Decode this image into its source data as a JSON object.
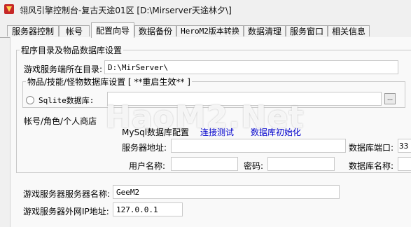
{
  "window": {
    "title": "翎风引擎控制台-复古天途01区 [D:\\Mirserver天途林夕\\]"
  },
  "tabs": [
    {
      "label": "服务器控制"
    },
    {
      "label": "帐号"
    },
    {
      "label": "配置向导"
    },
    {
      "label": "数据备份"
    },
    {
      "label": "HeroM2版本转换"
    },
    {
      "label": "数据清理"
    },
    {
      "label": "服务窗口"
    },
    {
      "label": "相关信息"
    }
  ],
  "active_tab": "配置向导",
  "wizard": {
    "section_title": "程序目录及物品数据库设置",
    "server_dir": {
      "label": "游戏服务端所在目录:",
      "value": "D:\\MirServer\\"
    },
    "db_group": {
      "title": "物品/技能/怪物数据库设置 [ **重启生效** ]",
      "sqlite": {
        "label": "Sqlite数据库:",
        "value": "",
        "browse": "..."
      }
    },
    "account_label": "帐号/角色/个人商店",
    "mysql": {
      "title": "MySql数据库配置",
      "test_link": "连接测试",
      "init_link": "数据库初始化",
      "server_addr_label": "服务器地址:",
      "server_addr_value": "",
      "port_label": "数据库端口:",
      "port_value": "33",
      "user_label": "用户名称:",
      "user_value": "",
      "password_label": "密码:",
      "password_value": "",
      "db_name_label": "数据库名称:",
      "db_name_value": ""
    },
    "server_name": {
      "label": "游戏服务器服务器名称:",
      "value": "GeeM2"
    },
    "server_ip": {
      "label": "游戏服务器外网IP地址:",
      "value": "127.0.0.1"
    }
  },
  "watermark": "HaoM2.Net"
}
